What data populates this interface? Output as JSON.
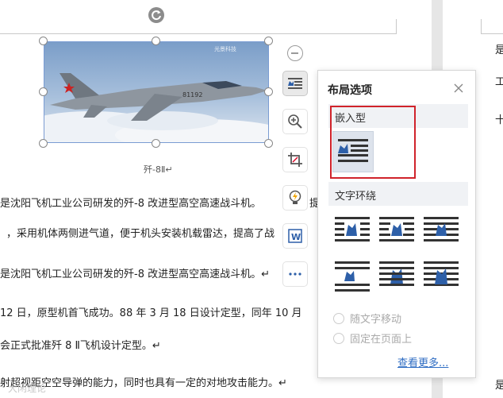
{
  "image": {
    "caption": "歼-8Ⅱ↵",
    "watermark_text": "光景科技"
  },
  "document_lines": [
    "是沈阳飞机工业公司研发的歼-8 改进型高空高速战斗机。",
    "，采用机体两侧进气道，便于机头安装机载雷达，提高了战",
    "是沈阳飞机工业公司研发的歼-8 改进型高空高速战斗机。↵",
    "12 日，原型机首飞成功。88 年 3 月 18 日设计定型，同年 10 月",
    "会正式批准歼 8 Ⅱ飞机设计定型。↵",
    "射超视距空空导弹的能力，同时也具有一定的对地攻击能力。↵"
  ],
  "right_page_chars": [
    "是",
    "工",
    "十",
    "是"
  ],
  "line_fragment": "提",
  "layout_popup": {
    "title": "布局选项",
    "inline_section_label": "嵌入型",
    "wrap_section_label": "文字环绕",
    "radio_move_with_text": "随文字移动",
    "radio_fix_on_page": "固定在页面上",
    "see_more_link": "查看更多..."
  },
  "side_toolbar": [
    "layout-options-icon",
    "zoom-in-icon",
    "crop-icon",
    "smart-edit-icon",
    "image-convert-icon",
    "more-icon"
  ],
  "footer_watermark": "大闲理论",
  "colors": {
    "highlight_red": "#d0232b",
    "link_blue": "#2f6dc3",
    "icon_blue": "#2d5fa8"
  }
}
